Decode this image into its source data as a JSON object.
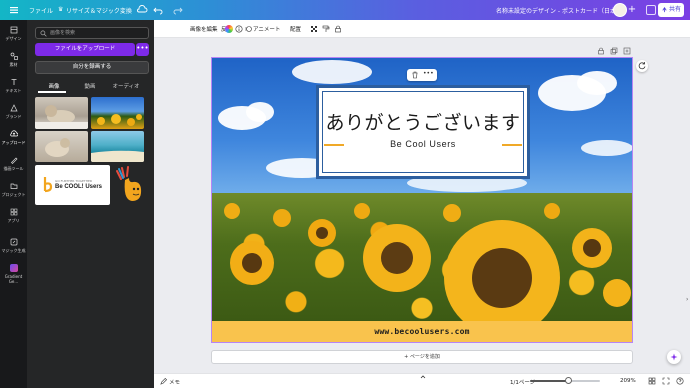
{
  "topbar": {
    "file_label": "ファイル",
    "resize_label": "リサイズ＆マジック変換",
    "doc_title": "名称未設定のデザイン - ポストカード（日本）",
    "share_label": "共有"
  },
  "rail": {
    "items": [
      {
        "label": "デザイン",
        "icon": "layout-icon"
      },
      {
        "label": "素材",
        "icon": "elements-icon"
      },
      {
        "label": "テキスト",
        "icon": "text-icon"
      },
      {
        "label": "ブランド",
        "icon": "brand-icon"
      },
      {
        "label": "アップロード",
        "icon": "upload-icon"
      },
      {
        "label": "描画ツール",
        "icon": "draw-icon"
      },
      {
        "label": "プロジェクト",
        "icon": "folder-icon"
      },
      {
        "label": "アプリ",
        "icon": "apps-icon"
      },
      {
        "label": "マジック生成",
        "icon": "magic-icon"
      },
      {
        "label": "Gradient Ge...",
        "icon": "gradient-app-icon"
      }
    ],
    "active_index": 4
  },
  "panel": {
    "search_placeholder": "画像を検索",
    "upload_button": "ファイルをアップロード",
    "more_button": "•••",
    "record_button": "自分を録画する",
    "tabs": [
      "画像",
      "動画",
      "オーディオ"
    ],
    "active_tab": 0,
    "logo_card_text": "Be COOL! Users",
    "logo_card_small": "GO FURTHER TOGETHER"
  },
  "toolbar": {
    "edit_image": "画像を編集",
    "flip": "反転",
    "animate": "アニメート",
    "position": "配置"
  },
  "design": {
    "title_jp": "ありがとうございます",
    "subtitle_en": "Be Cool Users",
    "footer_url": "www.becoolusers.com",
    "float_more": "•••"
  },
  "canvas": {
    "add_page": "+ ページを追加"
  },
  "bottombar": {
    "notes": "メモ",
    "page_indicator": "1/1ページ",
    "zoom": "209%",
    "zoom_fraction": 0.55
  },
  "colors": {
    "accent_purple": "#7d2ae8",
    "frame_blue": "#2c5e9f",
    "footer_yellow": "#f9c34d",
    "accent_orange": "#f0a928"
  }
}
